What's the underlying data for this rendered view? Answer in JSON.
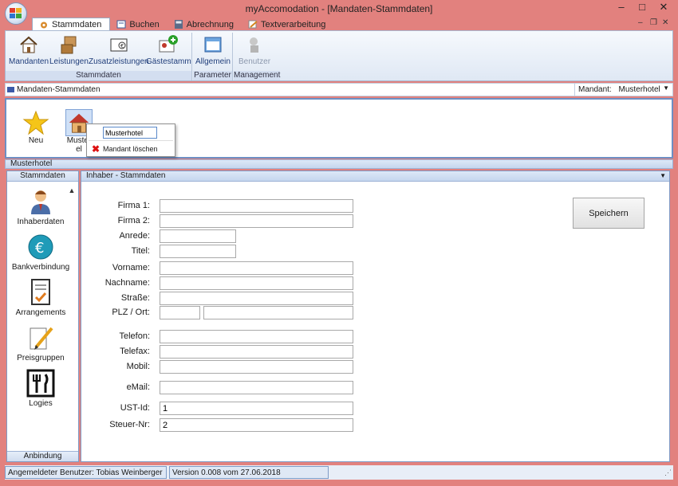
{
  "window": {
    "title": "myAccomodation - [Mandaten-Stammdaten]",
    "controls": {
      "minimize": "–",
      "maximize": "□",
      "close": "✕"
    },
    "mdi_controls": {
      "minimize": "–",
      "restore": "❐",
      "close": "✕"
    }
  },
  "ribbon": {
    "tabs": [
      {
        "label": "Stammdaten",
        "active": true
      },
      {
        "label": "Buchen"
      },
      {
        "label": "Abrechnung"
      },
      {
        "label": "Textverarbeitung"
      }
    ],
    "groups": [
      {
        "label": "Stammdaten",
        "buttons": [
          "Mandanten",
          "Leistungen",
          "Zusatzleistungen",
          "Gästestamm"
        ]
      },
      {
        "label": "Parameter",
        "buttons": [
          "Allgemein"
        ]
      },
      {
        "label": "Management",
        "buttons": [
          "Benutzer"
        ]
      }
    ]
  },
  "mandant_bar": {
    "title": "Mandaten-Stammdaten",
    "selector_label": "Mandant:",
    "selector_value": "Musterhotel"
  },
  "mandant_panel": {
    "items": [
      "Neu",
      "Musterhotel"
    ],
    "selected_label_visible": "Muster\nel",
    "context_menu": {
      "rename_value": "Musterhotel",
      "delete_label": "Mandant löschen"
    }
  },
  "section_header": "Musterhotel",
  "left_nav": {
    "header": "Stammdaten",
    "footer": "Anbindung",
    "items": [
      "Inhaberdaten",
      "Bankverbindung",
      "Arrangements",
      "Preisgruppen",
      "Logies"
    ]
  },
  "main": {
    "header": "Inhaber - Stammdaten",
    "save_label": "Speichern",
    "fields": [
      {
        "label": "Firma 1:",
        "value": ""
      },
      {
        "label": "Firma 2:",
        "value": ""
      },
      {
        "label": "Anrede:",
        "value": ""
      },
      {
        "label": "Titel:",
        "value": ""
      },
      {
        "label": "Vorname:",
        "value": ""
      },
      {
        "label": "Nachname:",
        "value": ""
      },
      {
        "label": "Straße:",
        "value": ""
      },
      {
        "label": "PLZ / Ort:",
        "value": "",
        "value2": ""
      },
      {
        "label": "Telefon:",
        "value": ""
      },
      {
        "label": "Telefax:",
        "value": ""
      },
      {
        "label": "Mobil:",
        "value": ""
      },
      {
        "label": "eMail:",
        "value": ""
      },
      {
        "label": "UST-Id:",
        "value": "1"
      },
      {
        "label": "Steuer-Nr:",
        "value": "2"
      }
    ]
  },
  "status": {
    "user": "Angemeldeter Benutzer: Tobias Weinberger",
    "version": "Version 0.008 vom 27.06.2018"
  }
}
